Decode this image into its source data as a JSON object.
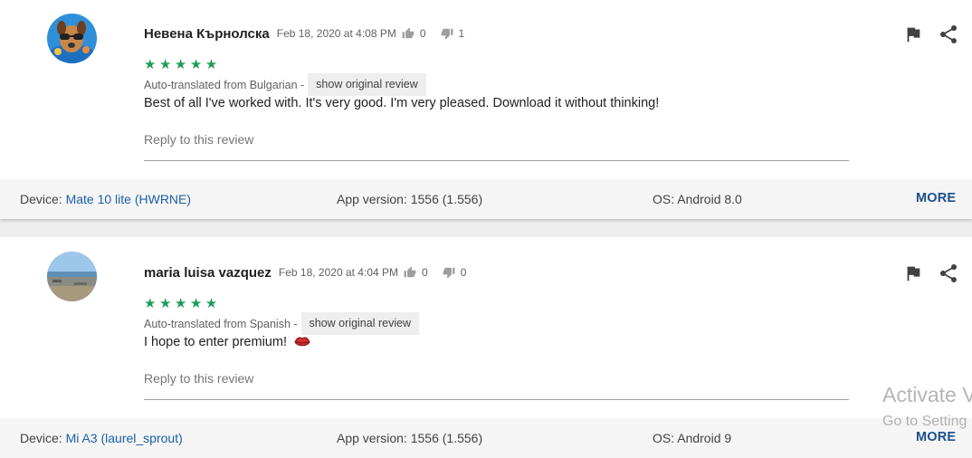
{
  "reviews": [
    {
      "author": "Невена Кърнолска",
      "date": "Feb 18, 2020 at 4:08 PM",
      "thumbs_up": "0",
      "thumbs_down": "1",
      "stars": "★★★★★",
      "rating": 5,
      "translated_label": "Auto-translated from Bulgarian -",
      "show_original_label": "show original review",
      "text": "Best of all I've worked with. It's very good. I'm very pleased. Download it without thinking!",
      "reply_placeholder": "Reply to this review",
      "device_label": "Device: ",
      "device_value": "Mate 10 lite (HWRNE)",
      "app_version": "App version: 1556 (1.556)",
      "os": "OS: Android 8.0",
      "more_label": "MORE"
    },
    {
      "author": "maria luisa vazquez",
      "date": "Feb 18, 2020 at 4:04 PM",
      "thumbs_up": "0",
      "thumbs_down": "0",
      "stars": "★★★★★",
      "rating": 5,
      "translated_label": "Auto-translated from Spanish -",
      "show_original_label": "show original review",
      "text": "I hope to enter premium!",
      "reply_placeholder": "Reply to this review",
      "device_label": "Device: ",
      "device_value": "Mi A3 (laurel_sprout)",
      "app_version": "App version: 1556 (1.556)",
      "os": "OS: Android 9",
      "more_label": "MORE"
    }
  ],
  "watermark": {
    "title": "Activate V",
    "subtitle": "Go to Setting"
  },
  "colors": {
    "star_green": "#1f9d55",
    "link_blue": "#1a5fa8",
    "more_blue": "#1a4f8b",
    "device_bar": "#f5f5f5"
  },
  "icons": [
    "thumbs-up-icon",
    "thumbs-down-icon",
    "flag-icon",
    "share-icon",
    "lips-emoji"
  ]
}
